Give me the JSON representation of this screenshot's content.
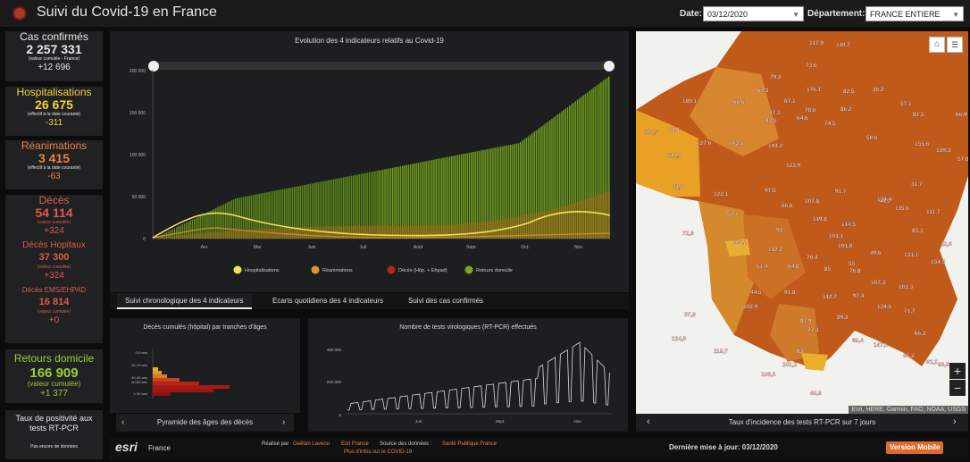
{
  "app": {
    "title": "Suivi du Covid-19 en France"
  },
  "filters": {
    "date_label": "Date:",
    "date_value": "03/12/2020",
    "dept_label": "Département:",
    "dept_value": "FRANCE ENTIERE"
  },
  "stats": {
    "confirmed": {
      "title": "Cas confirmés",
      "value": "2 257 331",
      "note": "(valeur cumulée - France)",
      "delta": "+12 696"
    },
    "hosp": {
      "title": "Hospitalisations",
      "value": "26 675",
      "note": "(effectif à la date courante)",
      "delta": "-311"
    },
    "rea": {
      "title": "Réanimations",
      "value": "3 415",
      "note": "(effectif à la date courante)",
      "delta": "-63"
    },
    "deaths": {
      "title": "Décès",
      "value": "54 114",
      "note": "(valeur cumulée)",
      "delta": "+324",
      "hosp_title": "Décès Hopitaux",
      "hosp_value": "37 300",
      "hosp_note": "(valeur cumulée)",
      "hosp_delta": "+324",
      "ems_title": "Décès EMS/EHPAD",
      "ems_value": "16 814",
      "ems_note": "(valeur cumulée)",
      "ems_delta": "+0"
    },
    "home": {
      "title": "Retours domicile",
      "value": "166 909",
      "note": "(valeur cumulée)",
      "delta": "+1 377"
    },
    "positivity": {
      "title": "Taux de positivité aux tests RT-PCR",
      "note": "Pas encore de données"
    }
  },
  "main_chart": {
    "title": "Evolution des 4 indicateurs relatifs au Covid-19",
    "y_ticks": [
      "200 000",
      "150 000",
      "100 000",
      "50 000",
      "0"
    ],
    "x_ticks": [
      "Avr.",
      "Mai",
      "Juin",
      "Juil.",
      "Août",
      "Sept.",
      "Oct.",
      "Nov."
    ],
    "legend": [
      "Hospitalisations",
      "Réanimations",
      "Décès (Hôp. + Ehpad)",
      "Retours domicile"
    ]
  },
  "tabs": [
    "Suivi chronologique des 4 indicateurs",
    "Ecarts quotidiens des 4 indicateurs",
    "Suivi des cas confirmés"
  ],
  "pyramid": {
    "title": "Décès cumulés (hôpital) par tranches d'âges",
    "ages": [
      "0-9 ans",
      "20-29 ans",
      "40-49 ans",
      "60-69 ans",
      "≥ 90 ans"
    ],
    "footer": "Pyramide des âges des décès"
  },
  "tests": {
    "title": "Nombre de tests virologiques (RT-PCR) effectués",
    "y_ticks": [
      "400 000",
      "200 000",
      "0"
    ],
    "x_ticks": [
      "Juil.",
      "Sept.",
      "Nov."
    ]
  },
  "map": {
    "attribution": "Esri, HERE, Garmin, FAO, NOAA, USGS",
    "caption": "Taux d'incidence des tests RT-PCR sur 7 jours",
    "labels": [
      "117,9",
      "110,7",
      "73,6",
      "79,3",
      "176,1",
      "67,3",
      "66,6",
      "189,1",
      "67,1",
      "78,6",
      "47,1",
      "64,6",
      "43,5",
      "74,5",
      "86,2",
      "82,5",
      "36,2",
      "57,1",
      "81,5",
      "66,9",
      "73,8",
      "102,5",
      "127,6",
      "173,5",
      "141,2",
      "50,6",
      "155,6",
      "159,3",
      "123,9",
      "31,3",
      "97,5",
      "107,8",
      "66,6",
      "114,9",
      "122,1",
      "91,7",
      "31,7",
      "57,8",
      "44,9",
      "111,7",
      "72,9",
      "53,1",
      "93",
      "112,2",
      "119,8",
      "114,5",
      "134,4",
      "85,3",
      "42,8",
      "70,4",
      "105,2",
      "131,1",
      "154,5",
      "85",
      "51,4",
      "112,7",
      "76,8",
      "134,6",
      "107,3",
      "103,3",
      "89,2",
      "71,7",
      "66,2",
      "59,4",
      "81,2",
      "115,6",
      "101,1",
      "91,8",
      "87,9",
      "97,4",
      "44,5",
      "77,3",
      "37,9",
      "124,5",
      "119,7",
      "106,3",
      "101,2",
      "147,6",
      "85,2",
      "93,8",
      "102,9",
      "83",
      "40,9",
      "55",
      "64,8",
      "49,6",
      "101,8"
    ]
  },
  "footer": {
    "brand": "esri",
    "brand_sub": "France",
    "credit_prefix": "Réalisé par",
    "author": "Geëtan Lavenu",
    "org": "Esri France",
    "source_label": "Source des données :",
    "source": "Santé Publique France",
    "more": "Plus d'infos sur le COVID-19",
    "updated": "Dernière mise à jour: 03/12/2020",
    "mobile": "Version Mobile"
  },
  "colors": {
    "hosp": "#f2e05a",
    "rea": "#e08a2a",
    "deaths": "#b02a1a",
    "home": "#7aa822"
  }
}
